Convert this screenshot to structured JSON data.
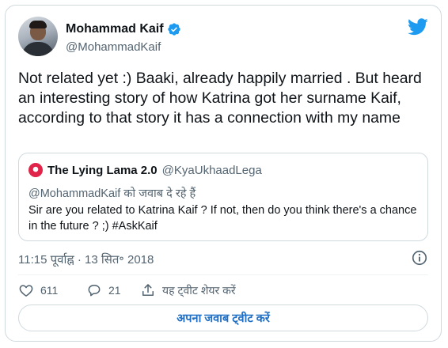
{
  "author": {
    "display_name": "Mohammad Kaif",
    "handle": "@MohammadKaif"
  },
  "tweet": {
    "text": "Not related yet :) Baaki, already happily married . But heard an interesting story of how Katrina got her surname Kaif, according to that story it has a connection with my name"
  },
  "quoted_tweet": {
    "display_name": "The Lying Lama 2.0",
    "handle": "@KyaUkhaadLega",
    "replying_to": "@MohammadKaif को जवाब दे रहे हैं",
    "text": "Sir are you related to Katrina Kaif ? If not, then do you think there's a chance in the future ? ;) #AskKaif"
  },
  "meta": {
    "timestamp": "11:15 पूर्वाह्न · 13 सित॰ 2018"
  },
  "actions": {
    "likes": "611",
    "replies": "21",
    "share_label": "यह ट्वीट शेयर करें"
  },
  "reply_button_label": "अपना जवाब ट्वीट करें",
  "colors": {
    "twitter_blue": "#1d9bf0",
    "text_primary": "#0f1419",
    "text_secondary": "#536471",
    "border": "#cfd9de",
    "quote_avatar": "#e0244a"
  },
  "icons": {
    "verified": "verified-badge-icon",
    "brand": "twitter-bird-icon",
    "info": "info-icon",
    "like": "heart-icon",
    "reply": "comment-bubble-icon",
    "share": "share-upload-icon"
  }
}
